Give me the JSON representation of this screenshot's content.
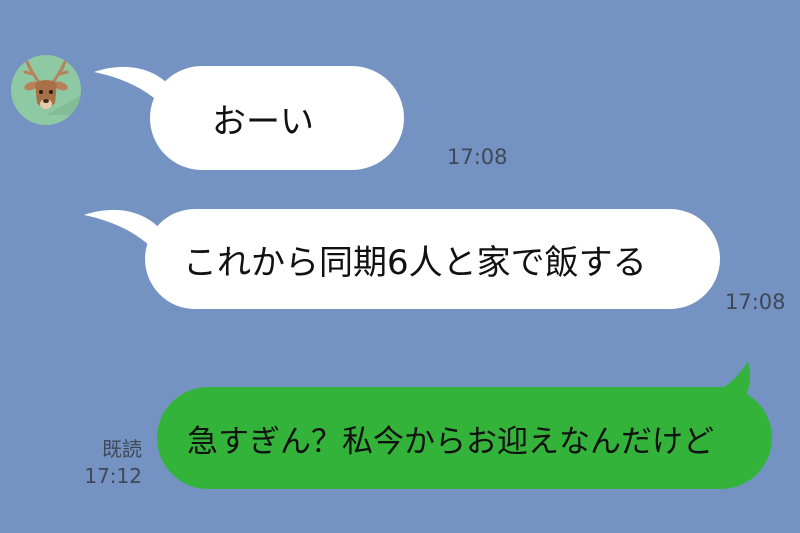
{
  "conversation": {
    "messages": [
      {
        "sender": "friend",
        "text": "おーい",
        "time": "17:08"
      },
      {
        "sender": "friend",
        "text": "これから同期6人と家で飯する",
        "time": "17:08"
      },
      {
        "sender": "me",
        "text": "急すぎん？私今からお迎えなんだけど",
        "time": "17:12",
        "read_label": "既読"
      }
    ]
  },
  "theme": {
    "background": "#7493c3",
    "incoming_bubble": "#ffffff",
    "outgoing_bubble": "#33b33a",
    "avatar_background": "#8fc9a3"
  },
  "avatar": {
    "icon": "deer-icon"
  }
}
